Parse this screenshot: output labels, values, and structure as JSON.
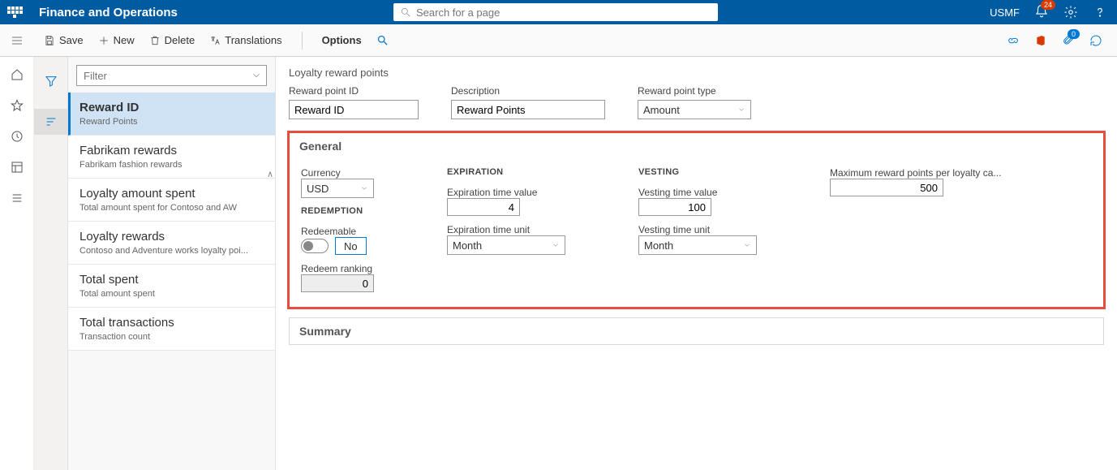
{
  "header": {
    "appTitle": "Finance and Operations",
    "searchPlaceholder": "Search for a page",
    "entity": "USMF",
    "notificationCount": "24"
  },
  "actions": {
    "save": "Save",
    "new": "New",
    "delete": "Delete",
    "translations": "Translations",
    "options": "Options",
    "attachCount": "0"
  },
  "list": {
    "filterPlaceholder": "Filter",
    "items": [
      {
        "title": "Reward ID",
        "sub": "Reward Points"
      },
      {
        "title": "Fabrikam rewards",
        "sub": "Fabrikam fashion rewards"
      },
      {
        "title": "Loyalty amount spent",
        "sub": "Total amount spent for Contoso and AW"
      },
      {
        "title": "Loyalty rewards",
        "sub": "Contoso and Adventure works loyalty poi..."
      },
      {
        "title": "Total spent",
        "sub": "Total amount spent"
      },
      {
        "title": "Total transactions",
        "sub": "Transaction count"
      }
    ]
  },
  "page": {
    "title": "Loyalty reward points",
    "fields": {
      "rewardPointIdLabel": "Reward point ID",
      "rewardPointId": "Reward ID",
      "descriptionLabel": "Description",
      "description": "Reward Points",
      "rewardPointTypeLabel": "Reward point type",
      "rewardPointType": "Amount"
    },
    "general": {
      "header": "General",
      "currencyLabel": "Currency",
      "currency": "USD",
      "redemptionHead": "REDEMPTION",
      "redeemableLabel": "Redeemable",
      "redeemableValue": "No",
      "redeemRankingLabel": "Redeem ranking",
      "redeemRanking": "0",
      "expirationHead": "EXPIRATION",
      "expTimeValueLabel": "Expiration time value",
      "expTimeValue": "4",
      "expTimeUnitLabel": "Expiration time unit",
      "expTimeUnit": "Month",
      "vestingHead": "VESTING",
      "vestTimeValueLabel": "Vesting time value",
      "vestTimeValue": "100",
      "vestTimeUnitLabel": "Vesting time unit",
      "vestTimeUnit": "Month",
      "maxPointsLabel": "Maximum reward points per loyalty ca...",
      "maxPoints": "500"
    },
    "summaryHeader": "Summary"
  }
}
